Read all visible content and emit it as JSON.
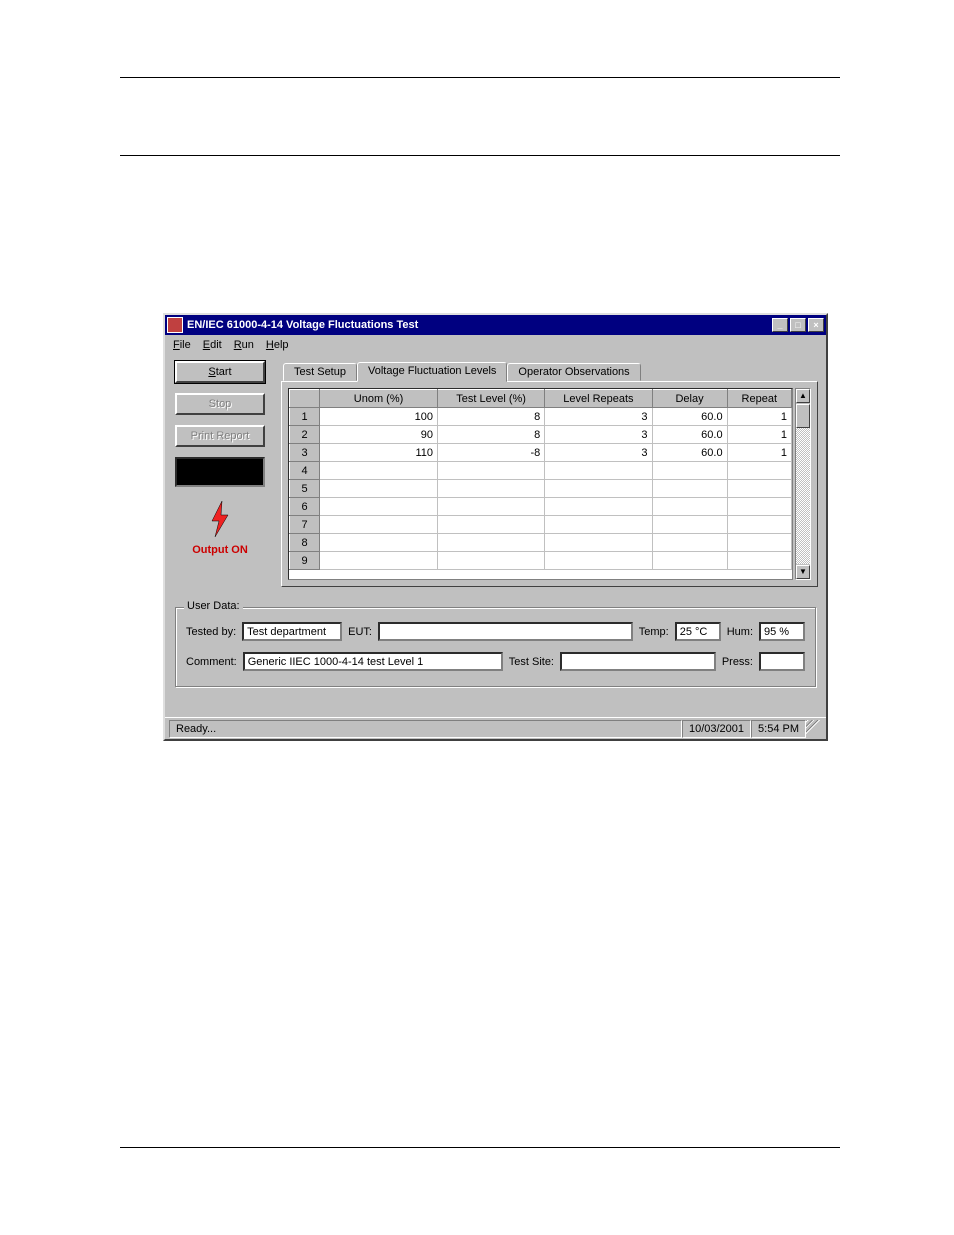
{
  "window": {
    "title": "EN/IEC 61000-4-14 Voltage Fluctuations Test",
    "min": "_",
    "max": "□",
    "close": "×"
  },
  "menu": {
    "file": "File",
    "edit": "Edit",
    "run": "Run",
    "help": "Help"
  },
  "buttons": {
    "start": "Start",
    "stop": "Stop",
    "print": "Print Report"
  },
  "output_label": "Output ON",
  "tabs": {
    "setup": "Test Setup",
    "levels": "Voltage Fluctuation Levels",
    "observations": "Operator Observations"
  },
  "grid": {
    "headers": {
      "unom": "Unom (%)",
      "testlevel": "Test Level (%)",
      "repeats": "Level Repeats",
      "delay": "Delay",
      "repeat": "Repeat"
    },
    "rows": [
      {
        "n": "1",
        "unom": "100",
        "tl": "8",
        "lr": "3",
        "d": "60.0",
        "r": "1"
      },
      {
        "n": "2",
        "unom": "90",
        "tl": "8",
        "lr": "3",
        "d": "60.0",
        "r": "1"
      },
      {
        "n": "3",
        "unom": "110",
        "tl": "-8",
        "lr": "3",
        "d": "60.0",
        "r": "1"
      },
      {
        "n": "4",
        "unom": "",
        "tl": "",
        "lr": "",
        "d": "",
        "r": ""
      },
      {
        "n": "5",
        "unom": "",
        "tl": "",
        "lr": "",
        "d": "",
        "r": ""
      },
      {
        "n": "6",
        "unom": "",
        "tl": "",
        "lr": "",
        "d": "",
        "r": ""
      },
      {
        "n": "7",
        "unom": "",
        "tl": "",
        "lr": "",
        "d": "",
        "r": ""
      },
      {
        "n": "8",
        "unom": "",
        "tl": "",
        "lr": "",
        "d": "",
        "r": ""
      },
      {
        "n": "9",
        "unom": "",
        "tl": "",
        "lr": "",
        "d": "",
        "r": ""
      }
    ]
  },
  "userdata": {
    "legend": "User Data:",
    "tested_by_label": "Tested by:",
    "tested_by": "Test department",
    "eut_label": "EUT:",
    "eut": "",
    "temp_label": "Temp:",
    "temp": "25 °C",
    "hum_label": "Hum:",
    "hum": "95 %",
    "comment_label": "Comment:",
    "comment": "Generic IIEC 1000-4-14 test Level 1",
    "site_label": "Test Site:",
    "site": "",
    "press_label": "Press:",
    "press": ""
  },
  "status": {
    "msg": "Ready...",
    "date": "10/03/2001",
    "time": "5:54 PM"
  },
  "scroll": {
    "up": "▲",
    "down": "▼"
  }
}
